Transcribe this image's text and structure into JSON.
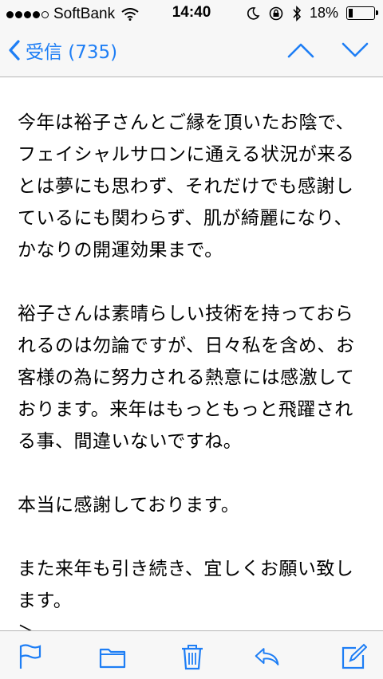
{
  "status_bar": {
    "carrier": "SoftBank",
    "time": "14:40",
    "battery_percent": "18%",
    "battery_level": 0.18
  },
  "nav": {
    "back_label": "受信 (735)",
    "accent_color": "#1e7ef5"
  },
  "message": {
    "paragraphs": [
      "今年は裕子さんとご縁を頂いたお陰で、フェイシャルサロンに通える状況が来るとは夢にも思わず、それだけでも感謝しているにも関わらず、肌が綺麗になり、かなりの開運効果まで。",
      "裕子さんは素晴らしい技術を持っておられるのは勿論ですが、日々私を含め、お客様の為に努力される熱意には感激しております。来年はもっともっと飛躍される事、間違いないですね。",
      "本当に感謝しております。",
      "また来年も引き続き、宜しくお願い致します。",
      "＞"
    ]
  },
  "toolbar": {
    "icons": [
      "flag-icon",
      "folder-icon",
      "trash-icon",
      "reply-icon",
      "compose-icon"
    ]
  }
}
